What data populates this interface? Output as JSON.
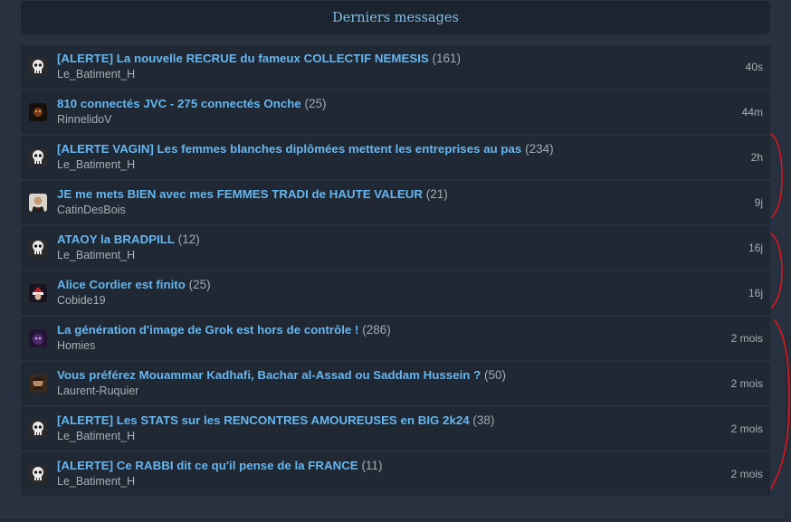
{
  "header": {
    "title": "Derniers messages"
  },
  "messages": [
    {
      "title": "[ALERTE] La nouvelle RECRUE du fameux COLLECTIF NEMESIS",
      "count": "(161)",
      "author": "Le_Batiment_H",
      "time": "40s",
      "avatar": "skull-avatar"
    },
    {
      "title": "810 connectés JVC - 275 connectés Onche",
      "count": "(25)",
      "author": "RinnelidoV",
      "time": "44m",
      "avatar": "dark-avatar"
    },
    {
      "title": "[ALERTE VAGIN] Les femmes blanches diplômées mettent les entreprises au pas",
      "count": "(234)",
      "author": "Le_Batiment_H",
      "time": "2h",
      "avatar": "skull-avatar"
    },
    {
      "title": "JE me mets BIEN avec mes FEMMES TRADI de HAUTE VALEUR",
      "count": "(21)",
      "author": "CatinDesBois",
      "time": "9j",
      "avatar": "suit-avatar"
    },
    {
      "title": "ATAOY la BRADPILL",
      "count": "(12)",
      "author": "Le_Batiment_H",
      "time": "16j",
      "avatar": "skull-avatar"
    },
    {
      "title": "Alice Cordier est finito",
      "count": "(25)",
      "author": "Cobide19",
      "time": "16j",
      "avatar": "santa-avatar"
    },
    {
      "title": "La génération d'image de Grok est hors de contrôle !",
      "count": "(286)",
      "author": "Homies",
      "time": "2 mois",
      "avatar": "purple-avatar"
    },
    {
      "title": "Vous préférez Mouammar Kadhafi, Bachar al-Assad ou Saddam Hussein ?",
      "count": "(50)",
      "author": "Laurent-Ruquier",
      "time": "2 mois",
      "avatar": "face-avatar"
    },
    {
      "title": "[ALERTE] Les STATS sur les RENCONTRES AMOUREUSES en BIG 2k24",
      "count": "(38)",
      "author": "Le_Batiment_H",
      "time": "2 mois",
      "avatar": "skull-avatar"
    },
    {
      "title": "[ALERTE] Ce RABBI dit ce qu'il pense de la FRANCE",
      "count": "(11)",
      "author": "Le_Batiment_H",
      "time": "2 mois",
      "avatar": "skull-avatar"
    }
  ],
  "colors": {
    "background": "#27313f",
    "row": "#1f2833",
    "link": "#66b6f0",
    "header_text": "#7fbfe8",
    "muted": "#a8aeb6",
    "annotation": "#e0141c"
  }
}
